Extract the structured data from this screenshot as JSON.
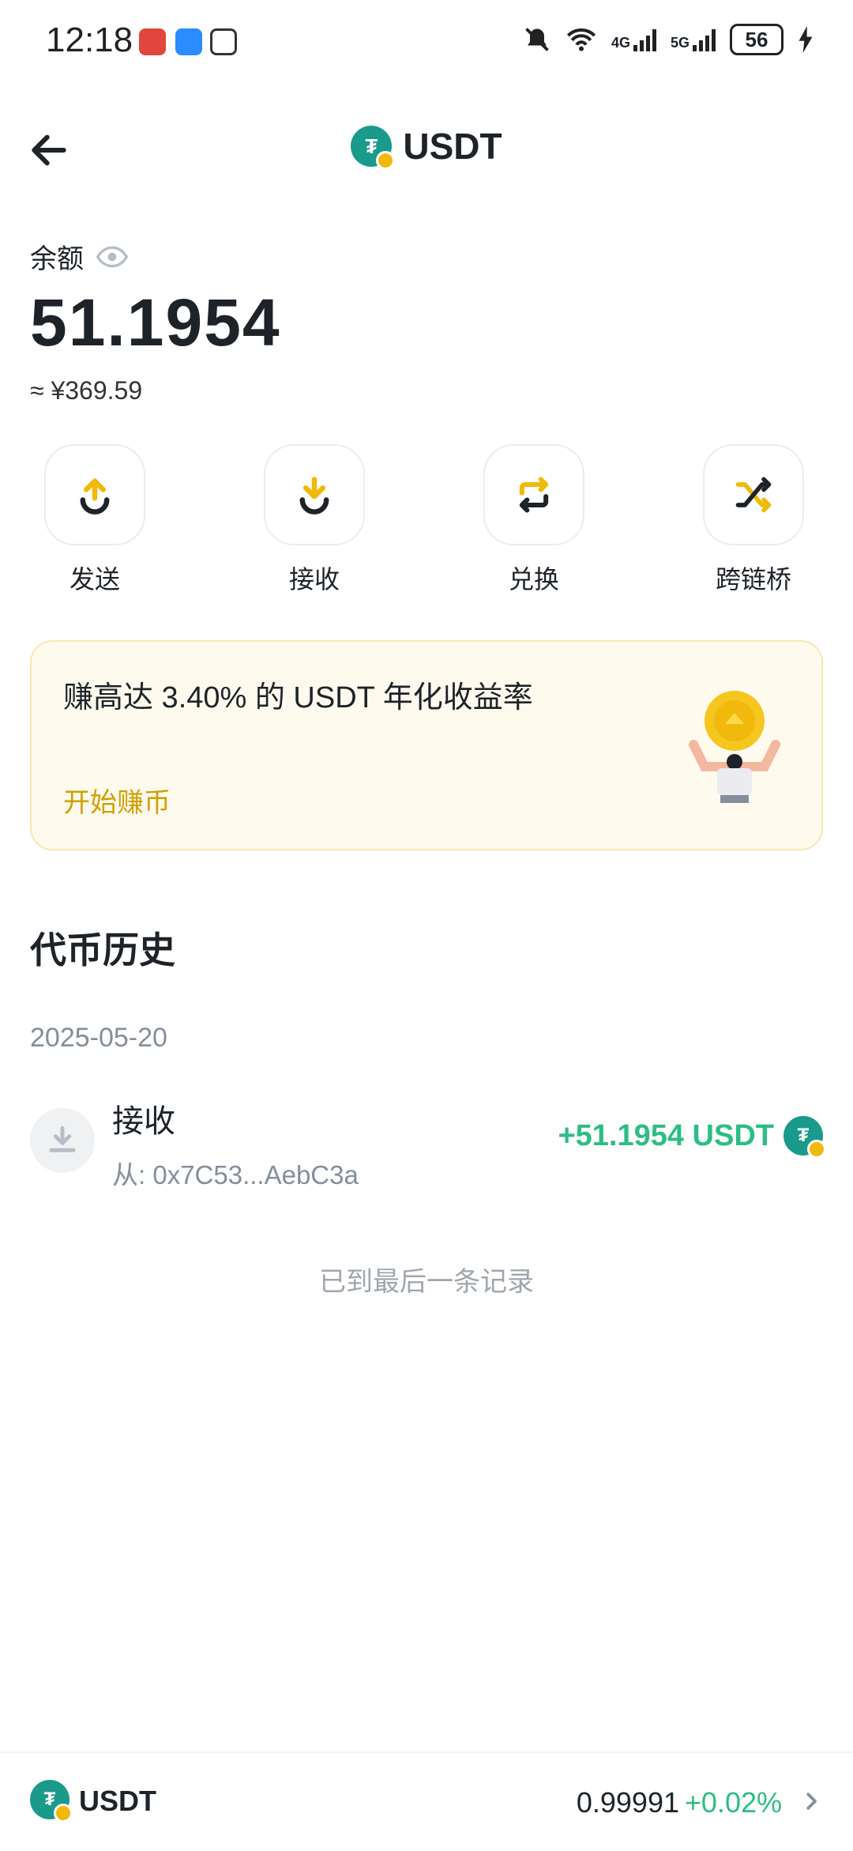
{
  "status_bar": {
    "time": "12:18",
    "battery": "56",
    "network1": "4G",
    "network2": "5G"
  },
  "header": {
    "title": "USDT"
  },
  "balance": {
    "label": "余额",
    "value": "51.1954",
    "fiat": "≈ ¥369.59"
  },
  "actions": [
    {
      "label": "发送",
      "icon": "send-icon"
    },
    {
      "label": "接收",
      "icon": "receive-icon"
    },
    {
      "label": "兑换",
      "icon": "swap-icon"
    },
    {
      "label": "跨链桥",
      "icon": "bridge-icon"
    }
  ],
  "promo": {
    "text": "赚高达 3.40% 的 USDT 年化收益率",
    "link": "开始赚币"
  },
  "history": {
    "title": "代币历史",
    "date": "2025-05-20",
    "transactions": [
      {
        "type": "接收",
        "from": "从: 0x7C53...AebC3a",
        "amount": "+51.1954 USDT"
      }
    ],
    "end_note": "已到最后一条记录"
  },
  "bottom_bar": {
    "coin": "USDT",
    "price": "0.99991",
    "change": "+0.02%"
  },
  "colors": {
    "accent": "#f0b90b",
    "positive": "#2ebd85",
    "coin": "#1a9a8a"
  }
}
